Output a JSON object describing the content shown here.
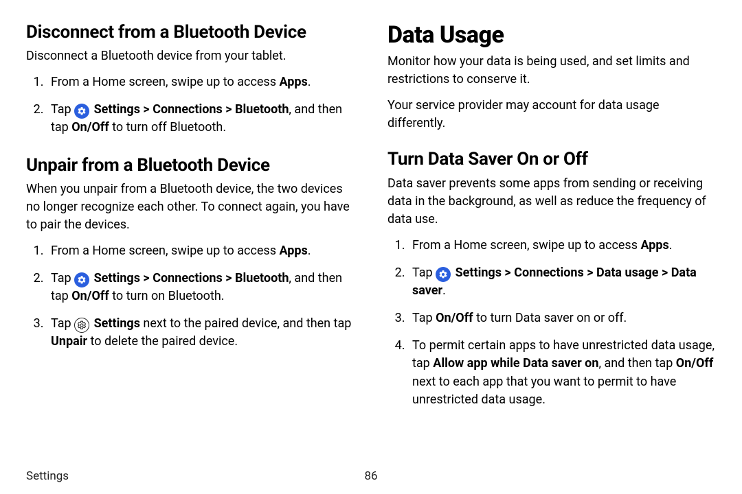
{
  "left": {
    "section1": {
      "heading": "Disconnect from a Bluetooth Device",
      "intro": "Disconnect a Bluetooth device from your tablet.",
      "step1_pre": "From a Home screen, swipe up to access ",
      "step1_bold": "Apps",
      "step1_post": ".",
      "step2_pre": "Tap ",
      "step2_path": "Settings > Connections > Bluetooth",
      "step2_mid": ", and then tap ",
      "step2_onoff": "On/Off",
      "step2_post": " to turn off Bluetooth."
    },
    "section2": {
      "heading": "Unpair from a Bluetooth Device",
      "intro": "When you unpair from a Bluetooth device, the two devices no longer recognize each other. To connect again, you have to pair the devices.",
      "step1_pre": "From a Home screen, swipe up to access ",
      "step1_bold": "Apps",
      "step1_post": ".",
      "step2_pre": "Tap ",
      "step2_path": "Settings > Connections > Bluetooth",
      "step2_mid": ", and then tap ",
      "step2_onoff": "On/Off",
      "step2_post": " to turn on Bluetooth.",
      "step3_pre": "Tap ",
      "step3_settings": "Settings",
      "step3_mid": " next to the paired device, and then tap ",
      "step3_unpair": "Unpair",
      "step3_post": " to delete the paired device."
    }
  },
  "right": {
    "title": "Data Usage",
    "intro1": "Monitor how your data is being used, and set limits and restrictions to conserve it.",
    "intro2": "Your service provider may account for data usage differently.",
    "section1": {
      "heading": "Turn Data Saver On or Off",
      "intro": "Data saver prevents some apps from sending or receiving data in the background, as well as reduce the frequency of data use.",
      "step1_pre": "From a Home screen, swipe up to access ",
      "step1_bold": "Apps",
      "step1_post": ".",
      "step2_pre": "Tap ",
      "step2_path": "Settings > Connections > Data usage > Data saver",
      "step2_post": ".",
      "step3_pre": "Tap ",
      "step3_onoff": "On/Off",
      "step3_post": " to turn Data saver on or off.",
      "step4_pre": "To permit certain apps to have unrestricted data usage, tap ",
      "step4_bold1": "Allow app while Data saver on",
      "step4_mid": ", and then tap ",
      "step4_bold2": "On/Off",
      "step4_post": " next to each app that you want to permit to have unrestricted data usage."
    }
  },
  "footer": {
    "label": "Settings",
    "page": "86"
  }
}
